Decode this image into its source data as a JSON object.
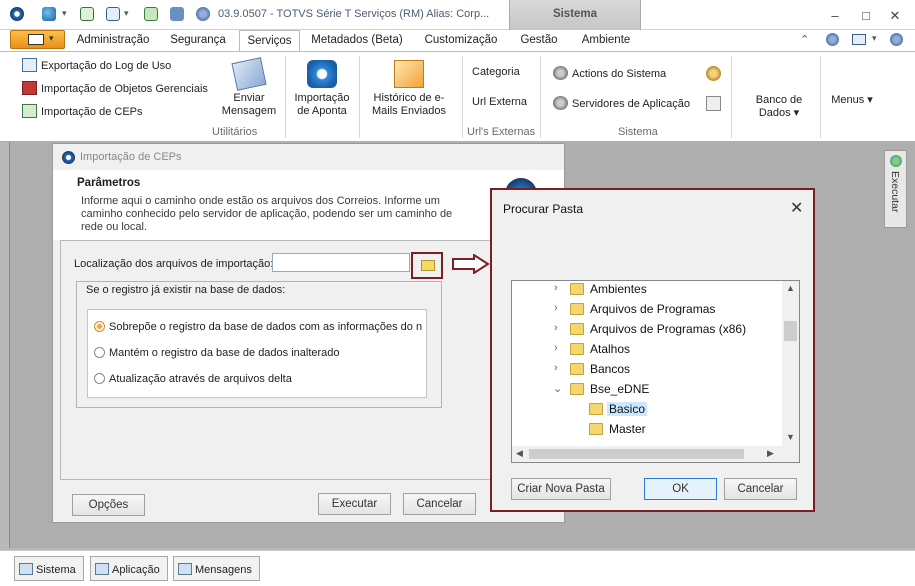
{
  "app": {
    "title": "03.9.0507 - TOTVS Série T Serviços (RM) Alias: Corp...",
    "context_tab": "Sistema",
    "window_controls": [
      "minimize-icon",
      "maximize-icon",
      "close-icon"
    ]
  },
  "tabs": [
    "Administração",
    "Segurança",
    "Serviços",
    "Metadados (Beta)",
    "Customização",
    "Gestão",
    "Ambiente"
  ],
  "active_tab": "Serviços",
  "ribbon": {
    "utilitarios": {
      "small": [
        "Exportação do Log de Uso",
        "Importação de Objetos Gerenciais",
        "Importação de CEPs"
      ],
      "big": [
        {
          "label": "Enviar Mensagem"
        },
        {
          "label": "Importação de Aponta"
        }
      ],
      "label": "Utilitários"
    },
    "historico": {
      "label": "Histórico de e-Mails Enviados"
    },
    "urls": {
      "items": [
        "Categoria",
        "Url Externa"
      ],
      "label": "Url's Externas"
    },
    "sistema": {
      "items": [
        "Actions do Sistema",
        "Servidores de Aplicação"
      ],
      "label": "Sistema"
    },
    "dados": {
      "label": "Banco de Dados ▾"
    },
    "menus": {
      "label": "Menus ▾"
    }
  },
  "executar": "Executar",
  "bottom_tabs": [
    "Sistema",
    "Aplicação",
    "Mensagens"
  ],
  "dialog_ceps": {
    "title": "Importação de CEPs",
    "section": "Parâmetros",
    "description": "Informe aqui o caminho onde estão os arquivos dos Correios. Informe um caminho conhecido pelo servidor de aplicação, podendo ser um caminho de rede ou local.",
    "location_label": "Localização dos arquivos de importação:",
    "location_value": "",
    "group_title": "Se o registro já existir na base de dados:",
    "options": [
      {
        "label": "Sobrepõe o registro da base de dados com as informações do nov",
        "selected": true
      },
      {
        "label": "Mantém o registro da base de dados inalterado",
        "selected": false
      },
      {
        "label": "Atualização através de arquivos delta",
        "selected": false
      }
    ],
    "buttons": {
      "options": "Opções",
      "execute": "Executar",
      "cancel": "Cancelar"
    }
  },
  "dialog_folder": {
    "title": "Procurar Pasta",
    "tree": [
      {
        "label": "Ambientes",
        "expanded": false,
        "level": 0
      },
      {
        "label": "Arquivos de Programas",
        "expanded": false,
        "level": 0
      },
      {
        "label": "Arquivos de Programas (x86)",
        "expanded": false,
        "level": 0
      },
      {
        "label": "Atalhos",
        "expanded": false,
        "level": 0
      },
      {
        "label": "Bancos",
        "expanded": false,
        "level": 0
      },
      {
        "label": "Bse_eDNE",
        "expanded": true,
        "level": 0
      },
      {
        "label": "Basico",
        "selected": true,
        "level": 1
      },
      {
        "label": "Master",
        "level": 1
      }
    ],
    "buttons": {
      "new_folder": "Criar Nova Pasta",
      "ok": "OK",
      "cancel": "Cancelar"
    }
  }
}
